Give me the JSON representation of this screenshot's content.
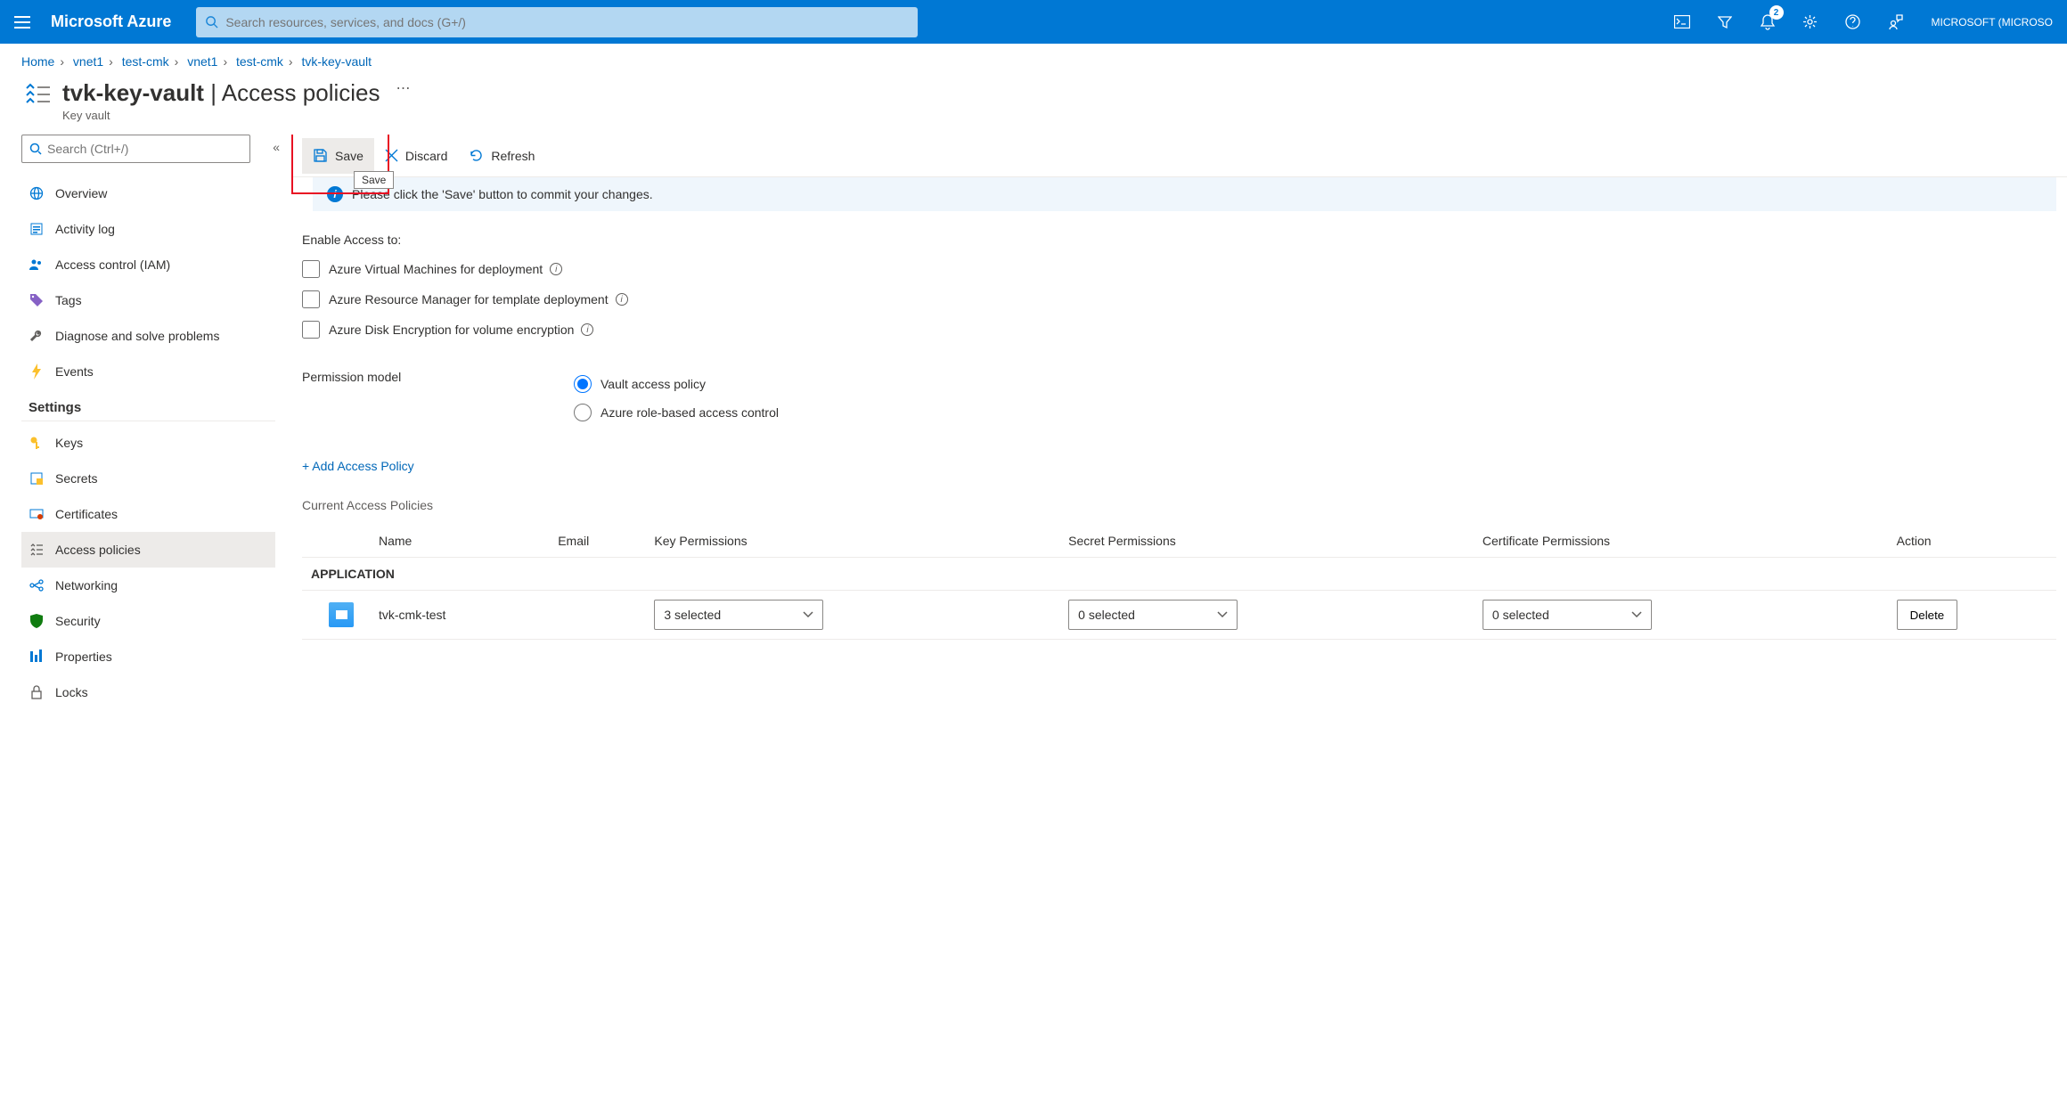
{
  "topbar": {
    "brand": "Microsoft Azure",
    "search_placeholder": "Search resources, services, and docs (G+/)",
    "notification_count": "2",
    "account_line1": "MICROSOFT (MICROSO"
  },
  "breadcrumbs": [
    "Home",
    "vnet1",
    "test-cmk",
    "vnet1",
    "test-cmk",
    "tvk-key-vault"
  ],
  "heading": {
    "title": "tvk-key-vault",
    "section": "Access policies",
    "resource_type": "Key vault"
  },
  "sidebar": {
    "search_placeholder": "Search (Ctrl+/)",
    "items_top": [
      {
        "label": "Overview",
        "icon": "globe"
      },
      {
        "label": "Activity log",
        "icon": "log"
      },
      {
        "label": "Access control (IAM)",
        "icon": "people"
      },
      {
        "label": "Tags",
        "icon": "tag"
      },
      {
        "label": "Diagnose and solve problems",
        "icon": "wrench"
      },
      {
        "label": "Events",
        "icon": "bolt"
      }
    ],
    "group_settings": "Settings",
    "items_settings": [
      {
        "label": "Keys",
        "icon": "key"
      },
      {
        "label": "Secrets",
        "icon": "secret"
      },
      {
        "label": "Certificates",
        "icon": "cert"
      },
      {
        "label": "Access policies",
        "icon": "policies",
        "selected": true
      },
      {
        "label": "Networking",
        "icon": "network"
      },
      {
        "label": "Security",
        "icon": "shield"
      },
      {
        "label": "Properties",
        "icon": "props"
      },
      {
        "label": "Locks",
        "icon": "lock"
      }
    ]
  },
  "toolbar": {
    "save_label": "Save",
    "discard_label": "Discard",
    "refresh_label": "Refresh",
    "tooltip": "Save"
  },
  "banner_text": "Please click the 'Save' button to commit your changes.",
  "enable_access_label": "Enable Access to:",
  "enable_access_options": [
    "Azure Virtual Machines for deployment",
    "Azure Resource Manager for template deployment",
    "Azure Disk Encryption for volume encryption"
  ],
  "permission_model": {
    "label": "Permission model",
    "option_vault": "Vault access policy",
    "option_rbac": "Azure role-based access control"
  },
  "add_policy_link": "+ Add Access Policy",
  "current_policies_label": "Current Access Policies",
  "table": {
    "headers": {
      "name": "Name",
      "email": "Email",
      "key": "Key Permissions",
      "secret": "Secret Permissions",
      "cert": "Certificate Permissions",
      "action": "Action"
    },
    "group_label": "APPLICATION",
    "rows": [
      {
        "name": "tvk-cmk-test",
        "email": "",
        "key_perm": "3 selected",
        "secret_perm": "0 selected",
        "cert_perm": "0 selected",
        "action": "Delete"
      }
    ]
  }
}
